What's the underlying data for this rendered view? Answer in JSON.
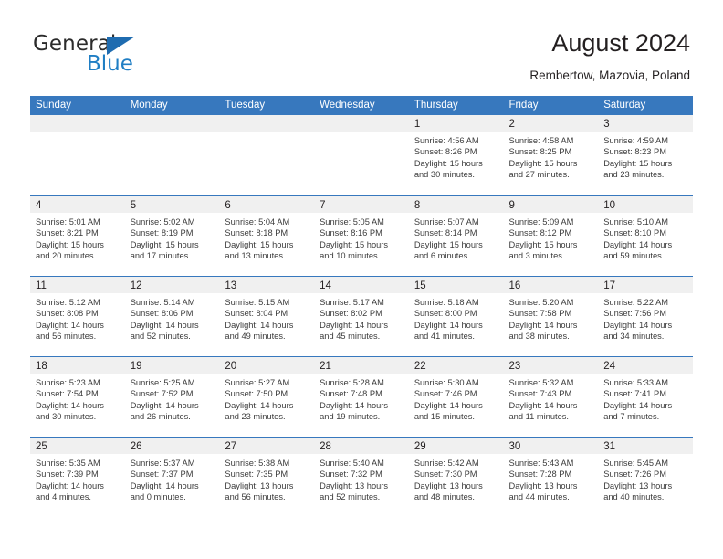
{
  "brand": {
    "name_top": "General",
    "name_bottom": "Blue",
    "triangle_color": "#1f6cb0",
    "blue_color": "#1f7ec4"
  },
  "header": {
    "title": "August 2024",
    "subtitle": "Rembertow, Mazovia, Poland"
  },
  "theme": {
    "header_blue": "#3778be",
    "day_band_gray": "#f0f0f0",
    "text": "#231f20"
  },
  "weekdays": [
    "Sunday",
    "Monday",
    "Tuesday",
    "Wednesday",
    "Thursday",
    "Friday",
    "Saturday"
  ],
  "labels": {
    "sunrise_prefix": "Sunrise:",
    "sunset_prefix": "Sunset:",
    "daylight_prefix": "Daylight:"
  },
  "weeks": [
    [
      {
        "day": "",
        "sunrise": "",
        "sunset": "",
        "daylight_line1": "",
        "daylight_line2": ""
      },
      {
        "day": "",
        "sunrise": "",
        "sunset": "",
        "daylight_line1": "",
        "daylight_line2": ""
      },
      {
        "day": "",
        "sunrise": "",
        "sunset": "",
        "daylight_line1": "",
        "daylight_line2": ""
      },
      {
        "day": "",
        "sunrise": "",
        "sunset": "",
        "daylight_line1": "",
        "daylight_line2": ""
      },
      {
        "day": "1",
        "sunrise": "Sunrise: 4:56 AM",
        "sunset": "Sunset: 8:26 PM",
        "daylight_line1": "Daylight: 15 hours",
        "daylight_line2": "and 30 minutes."
      },
      {
        "day": "2",
        "sunrise": "Sunrise: 4:58 AM",
        "sunset": "Sunset: 8:25 PM",
        "daylight_line1": "Daylight: 15 hours",
        "daylight_line2": "and 27 minutes."
      },
      {
        "day": "3",
        "sunrise": "Sunrise: 4:59 AM",
        "sunset": "Sunset: 8:23 PM",
        "daylight_line1": "Daylight: 15 hours",
        "daylight_line2": "and 23 minutes."
      }
    ],
    [
      {
        "day": "4",
        "sunrise": "Sunrise: 5:01 AM",
        "sunset": "Sunset: 8:21 PM",
        "daylight_line1": "Daylight: 15 hours",
        "daylight_line2": "and 20 minutes."
      },
      {
        "day": "5",
        "sunrise": "Sunrise: 5:02 AM",
        "sunset": "Sunset: 8:19 PM",
        "daylight_line1": "Daylight: 15 hours",
        "daylight_line2": "and 17 minutes."
      },
      {
        "day": "6",
        "sunrise": "Sunrise: 5:04 AM",
        "sunset": "Sunset: 8:18 PM",
        "daylight_line1": "Daylight: 15 hours",
        "daylight_line2": "and 13 minutes."
      },
      {
        "day": "7",
        "sunrise": "Sunrise: 5:05 AM",
        "sunset": "Sunset: 8:16 PM",
        "daylight_line1": "Daylight: 15 hours",
        "daylight_line2": "and 10 minutes."
      },
      {
        "day": "8",
        "sunrise": "Sunrise: 5:07 AM",
        "sunset": "Sunset: 8:14 PM",
        "daylight_line1": "Daylight: 15 hours",
        "daylight_line2": "and 6 minutes."
      },
      {
        "day": "9",
        "sunrise": "Sunrise: 5:09 AM",
        "sunset": "Sunset: 8:12 PM",
        "daylight_line1": "Daylight: 15 hours",
        "daylight_line2": "and 3 minutes."
      },
      {
        "day": "10",
        "sunrise": "Sunrise: 5:10 AM",
        "sunset": "Sunset: 8:10 PM",
        "daylight_line1": "Daylight: 14 hours",
        "daylight_line2": "and 59 minutes."
      }
    ],
    [
      {
        "day": "11",
        "sunrise": "Sunrise: 5:12 AM",
        "sunset": "Sunset: 8:08 PM",
        "daylight_line1": "Daylight: 14 hours",
        "daylight_line2": "and 56 minutes."
      },
      {
        "day": "12",
        "sunrise": "Sunrise: 5:14 AM",
        "sunset": "Sunset: 8:06 PM",
        "daylight_line1": "Daylight: 14 hours",
        "daylight_line2": "and 52 minutes."
      },
      {
        "day": "13",
        "sunrise": "Sunrise: 5:15 AM",
        "sunset": "Sunset: 8:04 PM",
        "daylight_line1": "Daylight: 14 hours",
        "daylight_line2": "and 49 minutes."
      },
      {
        "day": "14",
        "sunrise": "Sunrise: 5:17 AM",
        "sunset": "Sunset: 8:02 PM",
        "daylight_line1": "Daylight: 14 hours",
        "daylight_line2": "and 45 minutes."
      },
      {
        "day": "15",
        "sunrise": "Sunrise: 5:18 AM",
        "sunset": "Sunset: 8:00 PM",
        "daylight_line1": "Daylight: 14 hours",
        "daylight_line2": "and 41 minutes."
      },
      {
        "day": "16",
        "sunrise": "Sunrise: 5:20 AM",
        "sunset": "Sunset: 7:58 PM",
        "daylight_line1": "Daylight: 14 hours",
        "daylight_line2": "and 38 minutes."
      },
      {
        "day": "17",
        "sunrise": "Sunrise: 5:22 AM",
        "sunset": "Sunset: 7:56 PM",
        "daylight_line1": "Daylight: 14 hours",
        "daylight_line2": "and 34 minutes."
      }
    ],
    [
      {
        "day": "18",
        "sunrise": "Sunrise: 5:23 AM",
        "sunset": "Sunset: 7:54 PM",
        "daylight_line1": "Daylight: 14 hours",
        "daylight_line2": "and 30 minutes."
      },
      {
        "day": "19",
        "sunrise": "Sunrise: 5:25 AM",
        "sunset": "Sunset: 7:52 PM",
        "daylight_line1": "Daylight: 14 hours",
        "daylight_line2": "and 26 minutes."
      },
      {
        "day": "20",
        "sunrise": "Sunrise: 5:27 AM",
        "sunset": "Sunset: 7:50 PM",
        "daylight_line1": "Daylight: 14 hours",
        "daylight_line2": "and 23 minutes."
      },
      {
        "day": "21",
        "sunrise": "Sunrise: 5:28 AM",
        "sunset": "Sunset: 7:48 PM",
        "daylight_line1": "Daylight: 14 hours",
        "daylight_line2": "and 19 minutes."
      },
      {
        "day": "22",
        "sunrise": "Sunrise: 5:30 AM",
        "sunset": "Sunset: 7:46 PM",
        "daylight_line1": "Daylight: 14 hours",
        "daylight_line2": "and 15 minutes."
      },
      {
        "day": "23",
        "sunrise": "Sunrise: 5:32 AM",
        "sunset": "Sunset: 7:43 PM",
        "daylight_line1": "Daylight: 14 hours",
        "daylight_line2": "and 11 minutes."
      },
      {
        "day": "24",
        "sunrise": "Sunrise: 5:33 AM",
        "sunset": "Sunset: 7:41 PM",
        "daylight_line1": "Daylight: 14 hours",
        "daylight_line2": "and 7 minutes."
      }
    ],
    [
      {
        "day": "25",
        "sunrise": "Sunrise: 5:35 AM",
        "sunset": "Sunset: 7:39 PM",
        "daylight_line1": "Daylight: 14 hours",
        "daylight_line2": "and 4 minutes."
      },
      {
        "day": "26",
        "sunrise": "Sunrise: 5:37 AM",
        "sunset": "Sunset: 7:37 PM",
        "daylight_line1": "Daylight: 14 hours",
        "daylight_line2": "and 0 minutes."
      },
      {
        "day": "27",
        "sunrise": "Sunrise: 5:38 AM",
        "sunset": "Sunset: 7:35 PM",
        "daylight_line1": "Daylight: 13 hours",
        "daylight_line2": "and 56 minutes."
      },
      {
        "day": "28",
        "sunrise": "Sunrise: 5:40 AM",
        "sunset": "Sunset: 7:32 PM",
        "daylight_line1": "Daylight: 13 hours",
        "daylight_line2": "and 52 minutes."
      },
      {
        "day": "29",
        "sunrise": "Sunrise: 5:42 AM",
        "sunset": "Sunset: 7:30 PM",
        "daylight_line1": "Daylight: 13 hours",
        "daylight_line2": "and 48 minutes."
      },
      {
        "day": "30",
        "sunrise": "Sunrise: 5:43 AM",
        "sunset": "Sunset: 7:28 PM",
        "daylight_line1": "Daylight: 13 hours",
        "daylight_line2": "and 44 minutes."
      },
      {
        "day": "31",
        "sunrise": "Sunrise: 5:45 AM",
        "sunset": "Sunset: 7:26 PM",
        "daylight_line1": "Daylight: 13 hours",
        "daylight_line2": "and 40 minutes."
      }
    ]
  ]
}
